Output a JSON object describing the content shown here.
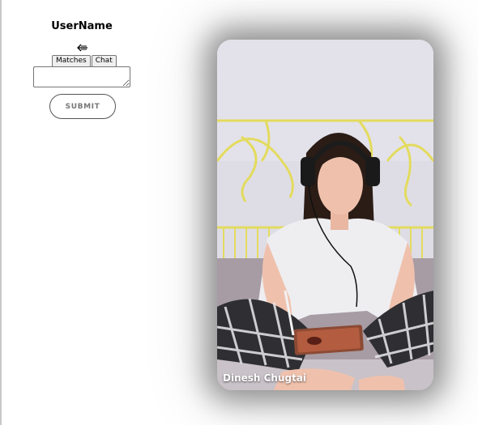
{
  "sidebar": {
    "username": "UserName",
    "back_icon": "back-arrow-icon",
    "tabs": [
      {
        "label": "Matches"
      },
      {
        "label": "Chat"
      }
    ],
    "message_input": {
      "value": "",
      "placeholder": ""
    },
    "submit_label": "SUBMIT"
  },
  "card": {
    "name": "Dinesh Chugtai",
    "photo_description_icon": "profile-photo"
  },
  "colors": {
    "wall": "#dcdbe4",
    "headboard": "#e6de63",
    "shirt": "#f0f0f2",
    "hair": "#2b1c16"
  }
}
